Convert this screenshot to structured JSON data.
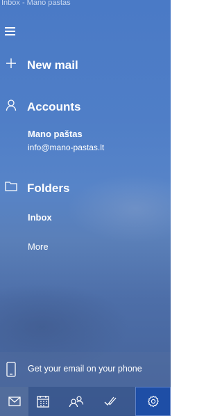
{
  "window": {
    "title": "Inbox - Mano pastas"
  },
  "nav": {
    "new_mail_label": "New mail",
    "accounts_label": "Accounts",
    "account": {
      "name": "Mano paštas",
      "email": "info@mano-pastas.lt"
    },
    "folders_label": "Folders",
    "folder_items": [
      "Inbox",
      "More"
    ]
  },
  "promo": {
    "label": "Get your email on your phone"
  },
  "tabbar": {
    "tabs": [
      "mail-icon",
      "calendar-icon",
      "people-icon",
      "todo-icon",
      "settings-icon"
    ],
    "active": "mail-icon",
    "highlight_color": "#1e4ea6"
  },
  "colors": {
    "background": "#4f7ec7",
    "text": "#ffffff"
  }
}
